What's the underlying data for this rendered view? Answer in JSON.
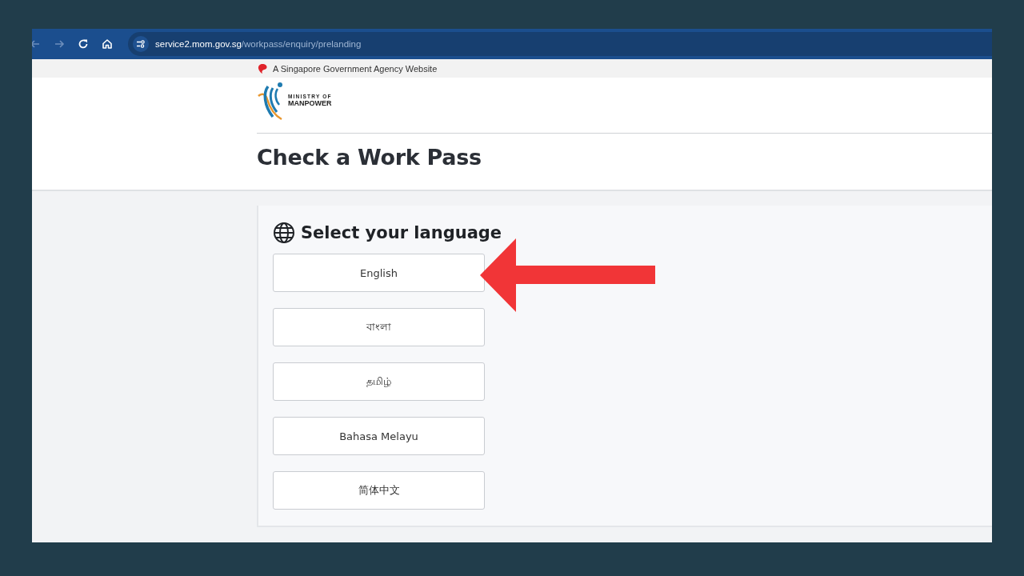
{
  "browser": {
    "url_host": "service2.mom.gov.sg",
    "url_path": "/workpass/enquiry/prelanding"
  },
  "banner": {
    "text": "A Singapore Government Agency Website"
  },
  "logo": {
    "line_1": "MINISTRY OF",
    "line_2": "MANPOWER"
  },
  "page_title": "Check a Work Pass",
  "language_panel": {
    "heading": "Select your language",
    "options": [
      {
        "label": "English"
      },
      {
        "label": "বাংলা"
      },
      {
        "label": "தமிழ்"
      },
      {
        "label": "Bahasa Melayu"
      },
      {
        "label": "简体中文"
      }
    ]
  }
}
